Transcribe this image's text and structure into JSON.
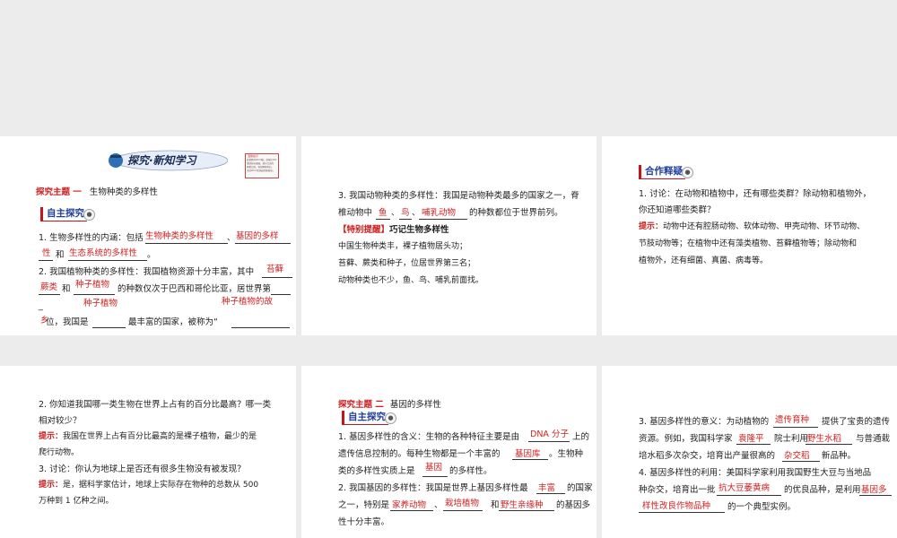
{
  "s1": {
    "banner": "探究·新知学习",
    "note_lines": [
      "温馨提示",
      "此套题为Word版，请按住Ctrl",
      "滑动鼠标滚轴，调节合适的",
      "观看比例，答案解析附后。",
      "关闭Word文档返回原板块。"
    ],
    "topic_label": "探究主题 一",
    "topic_title": "生物种类的多样性",
    "tag": "自主探究",
    "q1a": "1. 生物多样性的内涵：包括",
    "q1_ans1": "生物种类的多样性",
    "q1_sep": "、",
    "q1_ans2": "基因的多样",
    "q1_ans2b": "性",
    "q1_and": "和",
    "q1_ans3": "生态系统的多样性",
    "q1_end": "。",
    "q2a": "2. 我国植物种类的多样性：我国植物资源十分丰富，其中",
    "q2_ans1": "苔藓",
    "q2_ans1b": "蕨类",
    "q2_and": "和",
    "q2_ans2": "种子植物",
    "q2_mid": "的种数仅次于巴西和哥伦比亚，居世界第",
    "q2_ans3": "种子植物",
    "q2_ans4": "种子植物的故",
    "q2_ans4b": "乡",
    "q2_b": "位，我国是",
    "q2_c": "最丰富的国家，被称为“",
    "q2_end": "”。"
  },
  "s2": {
    "q3a": "3. 我国动物种类的多样性：我国是动物种类最多的国家之一，脊",
    "q3b": "椎动物中",
    "ans_fish": "鱼",
    "sep": "、",
    "ans_bird": "鸟",
    "ans_mammal": "哺乳动物",
    "q3c": "的种数都位于世界前列。",
    "special_label": "【特别提醒】",
    "special_title": "巧记生物多样性",
    "special_lines": [
      "中国生物种类丰，裸子植物居头功；",
      "苔藓、蕨类和种子，位居世界第三名；",
      "动物种类也不少，鱼、鸟、哺乳前面找。"
    ]
  },
  "s3": {
    "tag": "合作释疑",
    "d1a": "1. 讨论：在动物和植物中，还有哪些类群？除动物和植物外，",
    "d1b": "你还知道哪些类群？",
    "hint_label": "提示：",
    "hint1": "动物中还有腔肠动物、软体动物、甲壳动物、环节动物、",
    "hint2": "节肢动物等；在植物中还有藻类植物、苔藓植物等；除动物和",
    "hint3": "植物外，还有细菌、真菌、病毒等。"
  },
  "s4": {
    "q2a": "2. 你知道我国哪一类生物在世界上占有的百分比最高？哪一类",
    "q2b": "相对较少？",
    "hint_label": "提示：",
    "hint2a": "我国在世界上占有百分比最高的是裸子植物，最少的是",
    "hint2b": "爬行动物。",
    "q3": "3. 讨论：你认为地球上是否还有很多生物没有被发现？",
    "hint3a": "是，据科学家估计，地球上实际存在物种的总数从 500",
    "hint3b": "万种到 1 亿种之间。"
  },
  "s5": {
    "topic_label": "探究主题 二",
    "topic_title": "基因的多样性",
    "tag": "自主探究",
    "l1a": "1. 基因多样性的含义：生物的各种特征主要是由",
    "ans_dna": "DNA 分子",
    "l1b": "上的",
    "l2a": "遗传信息控制的。每种生物都是一个丰富的",
    "ans_lib": "基因库",
    "l2b": "。生物种",
    "l3a": "类的多样性实质上是",
    "ans_gene": "基因",
    "l3b": "的多样性。",
    "l4a": "2. 我国基因的多样性：我国是世界上基因多样性最",
    "ans_rich": "丰富",
    "l4b": "的国家",
    "l5a": "之一，特别是",
    "ans_dom_animal": "家养动物",
    "sep": "、",
    "ans_crop": "栽培植物",
    "and": "和",
    "ans_wild": "野生亲缘种",
    "l5b": "的基因多",
    "l6": "性十分丰富。"
  },
  "s6": {
    "l1a": "3. 基因多样性的意义：为动植物的",
    "ans_breed": "遗传育种",
    "l1b": "提供了宝贵的遗传",
    "l2a": "资源。例如，我国科学家",
    "ans_yuan": "袁隆平",
    "l2b": "院士利用",
    "ans_wildrice": "野生水稻",
    "l2c": "与普通栽",
    "l3a": "培水稻多次杂交，培育出产量很高的",
    "ans_hybrid": "杂交稻",
    "l3b": "新品种。",
    "l4": "4. 基因多样性的利用：美国科学家利用我国野生大豆与当地品",
    "l5a": "种杂交，培育出一批",
    "ans_resist": "抗大豆萎黄病",
    "l5b": "的优良品种，是利用",
    "ans_div": "基因多",
    "l6a_ans": "样性改良作物品种",
    "l6b": "的一个典型实例。"
  }
}
